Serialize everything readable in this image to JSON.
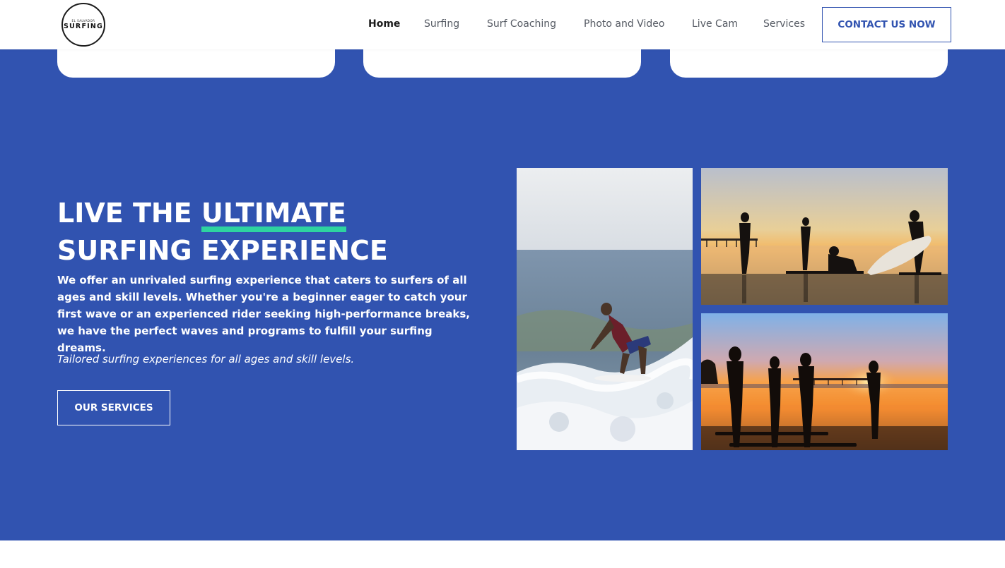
{
  "header": {
    "logo": {
      "small_text": "EL SALVADOR",
      "main_text": "SURFING"
    },
    "nav": [
      {
        "label": "Home",
        "active": true
      },
      {
        "label": "Surfing",
        "active": false
      },
      {
        "label": "Surf Coaching",
        "active": false
      },
      {
        "label": "Photo and Video",
        "active": false
      },
      {
        "label": "Live Cam",
        "active": false
      },
      {
        "label": "Services",
        "active": false
      }
    ],
    "contact_label": "CONTACT US NOW"
  },
  "hero": {
    "headline_part1": "LIVE THE ",
    "headline_highlight": "ULTIMATE",
    "headline_line2": "SURFING EXPERIENCE",
    "description": "We offer an unrivaled surfing experience that caters to surfers of all ages and skill levels. Whether you're a beginner eager to catch your first wave or an experienced rider seeking high-performance breaks, we have the perfect waves and programs to fulfill your surfing dreams.",
    "tagline": "Tailored surfing experiences for all ages and skill levels.",
    "cta_label": "OUR SERVICES"
  },
  "colors": {
    "brand_blue": "#3153b0",
    "highlight_green": "#2ed3a0",
    "white": "#ffffff"
  }
}
